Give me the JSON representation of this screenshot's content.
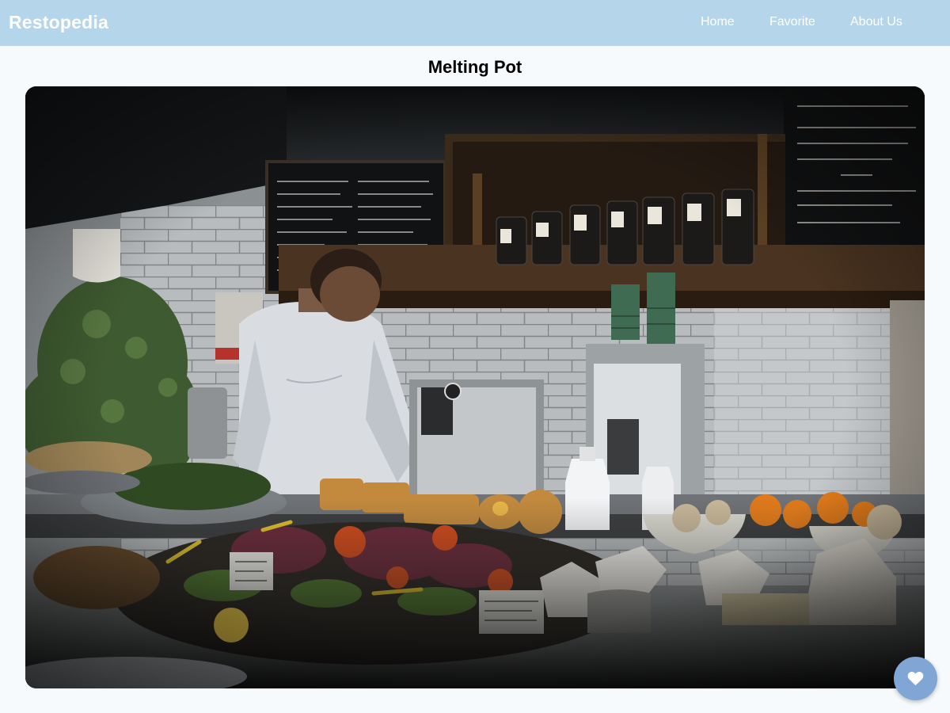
{
  "navbar": {
    "brand": "Restopedia",
    "links": [
      "Home",
      "Favorite",
      "About Us"
    ]
  },
  "restaurant": {
    "name": "Melting Pot",
    "image_alt": "Restaurant interior with a chef working behind a counter of food"
  },
  "favorite_button": {
    "icon": "heart-icon"
  },
  "colors": {
    "navbar_bg": "#b5d5ea",
    "page_bg": "#f6fafc",
    "favorite_button_bg": "#7fa6d4"
  }
}
